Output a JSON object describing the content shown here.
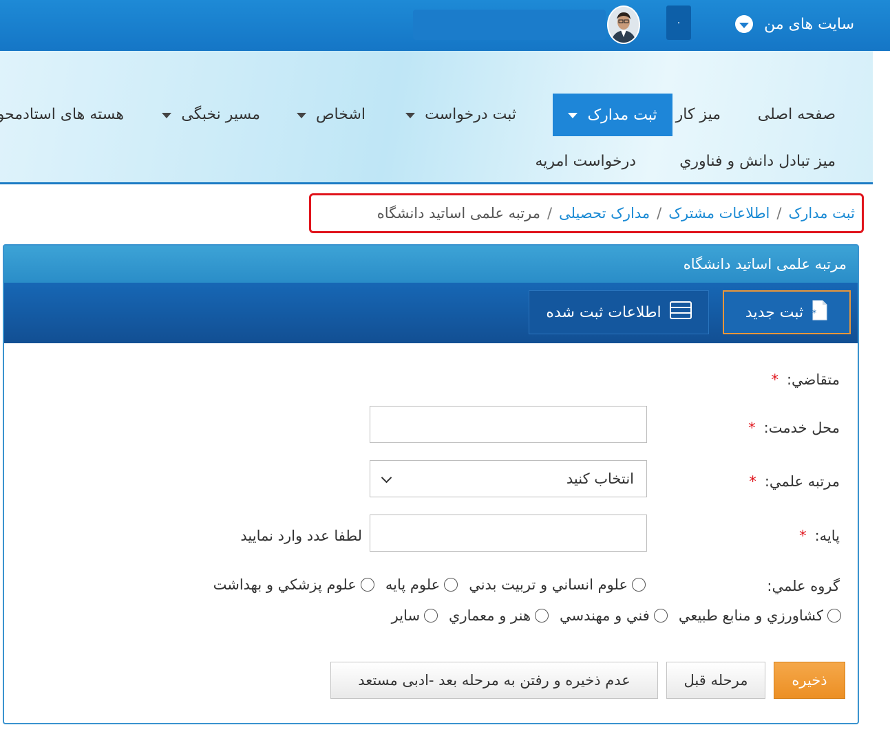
{
  "topbar": {
    "my_sites_label": "سایت های من",
    "notification_count": "۰"
  },
  "nav": {
    "items": [
      {
        "label": "صفحه اصلی"
      },
      {
        "label": "ميز کار"
      },
      {
        "label": "ثبت مدارک"
      },
      {
        "label": "ثبت درخواست"
      },
      {
        "label": "اشخاص"
      },
      {
        "label": "مسير نخبگی"
      },
      {
        "label": "هسته های استادمحو"
      },
      {
        "label": "ميز تبادل دانش و فناوري"
      },
      {
        "label": "درخواست امريه"
      }
    ]
  },
  "breadcrumb": {
    "items": [
      "ثبت مدارک",
      "اطلاعات مشترک",
      "مدارک تحصيلی",
      "مرتبه علمی اساتيد دانشگاه"
    ],
    "separator": "/"
  },
  "panel": {
    "title": "مرتبه علمی اساتيد دانشگاه",
    "tab_new": "ثبت جديد",
    "tab_list": "اطلاعات ثبت شده"
  },
  "form": {
    "required_mark": "*",
    "applicant_label": "متقاضي:",
    "service_place_label": "محل خدمت:",
    "service_place_value": "",
    "rank_label": "مرتبه علمي:",
    "rank_selected": "انتخاب كنيد",
    "base_label": "پايه:",
    "base_value": "",
    "base_hint": "لطفا عدد وارد نماييد",
    "group_label": "گروه علمي:",
    "groups_row1": [
      "علوم انساني و تربيت بدني",
      "علوم پايه",
      "علوم پزشكي و بهداشت"
    ],
    "groups_row2": [
      "كشاورزي و منابع طبيعي",
      "فني و مهندسي",
      "هنر و معماري",
      "ساير"
    ]
  },
  "buttons": {
    "save": "ذخيره",
    "previous": "مرحله قبل",
    "skip": "عدم ذخيره و رفتن به مرحله بعد -ادبی مستعد"
  },
  "colors": {
    "topbar": "#1576c6",
    "active_nav": "#1e86d8",
    "link": "#1a8ad4",
    "highlight_border": "#e0141c",
    "save_button": "#ec8f24",
    "required": "#e0141c"
  }
}
